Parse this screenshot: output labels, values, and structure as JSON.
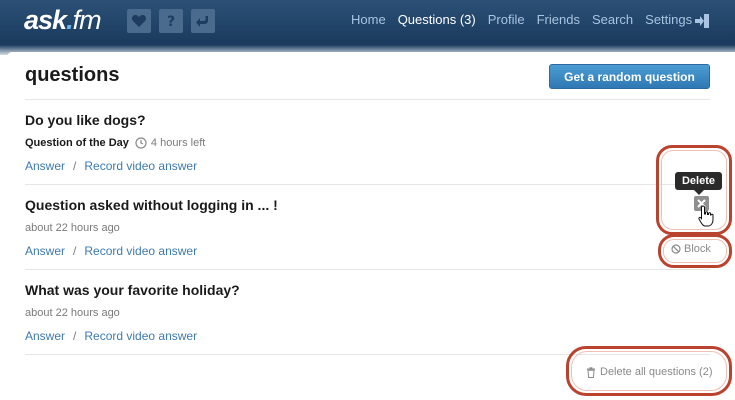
{
  "app": {
    "logo_main": "ask",
    "logo_dot": ".",
    "logo_suffix": "fm"
  },
  "nav": {
    "icons": [
      "heart-icon",
      "question-icon",
      "reply-icon"
    ],
    "links": [
      {
        "label": "Home",
        "active": false
      },
      {
        "label": "Questions (3)",
        "active": true
      },
      {
        "label": "Profile",
        "active": false
      },
      {
        "label": "Friends",
        "active": false
      },
      {
        "label": "Search",
        "active": false
      },
      {
        "label": "Settings",
        "active": false
      }
    ],
    "logout_icon": "logout-icon"
  },
  "page": {
    "title": "questions",
    "random_button": "Get a random question"
  },
  "questions": [
    {
      "title": "Do you like dogs?",
      "badge": "Question of the Day",
      "meta": "4 hours left",
      "answer": "Answer",
      "separator": "/",
      "video": "Record video answer"
    },
    {
      "title": "Question asked without logging in ... !",
      "meta": "about 22 hours ago",
      "answer": "Answer",
      "separator": "/",
      "video": "Record video answer"
    },
    {
      "title": "What was your favorite holiday?",
      "meta": "about 22 hours ago",
      "answer": "Answer",
      "separator": "/",
      "video": "Record video answer"
    }
  ],
  "tooltip": "Delete",
  "block": "Block",
  "delete_all": "Delete all questions (2)",
  "colors": {
    "nav_bg": "#22456a",
    "accent": "#3d7ab0",
    "button": "#2f78b3",
    "annotation": "#b9432e"
  }
}
